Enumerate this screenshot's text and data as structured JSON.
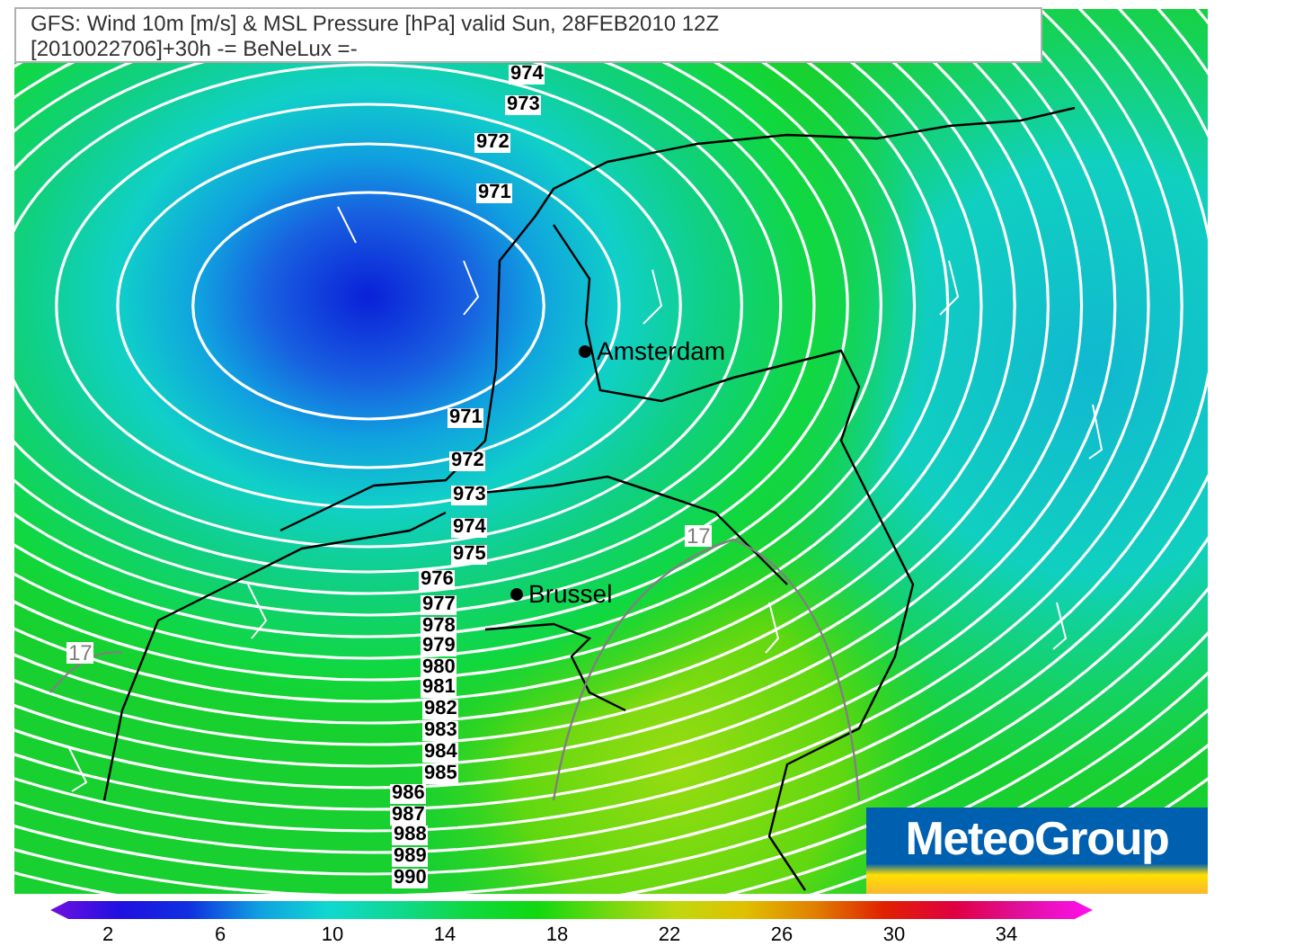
{
  "header": {
    "title": "GFS: Wind 10m [m/s] & MSL Pressure [hPa] valid Sun, 28FEB2010 12Z",
    "subtitle": "[2010022706]+30h -= BeNeLux =-"
  },
  "map": {
    "isobar_labels": [
      "974",
      "973",
      "972",
      "971",
      "971",
      "972",
      "973",
      "974",
      "975",
      "976",
      "977",
      "978",
      "979",
      "980",
      "981",
      "982",
      "983",
      "984",
      "985",
      "986",
      "987",
      "988",
      "989",
      "990"
    ],
    "isotach_labels": [
      "17",
      "17"
    ],
    "cities": [
      {
        "name": "Amsterdam"
      },
      {
        "name": "Brussel"
      }
    ]
  },
  "logo": {
    "text": "MeteoGroup"
  },
  "color_scale": {
    "ticks": [
      "2",
      "6",
      "10",
      "14",
      "18",
      "22",
      "26",
      "30",
      "34"
    ]
  }
}
